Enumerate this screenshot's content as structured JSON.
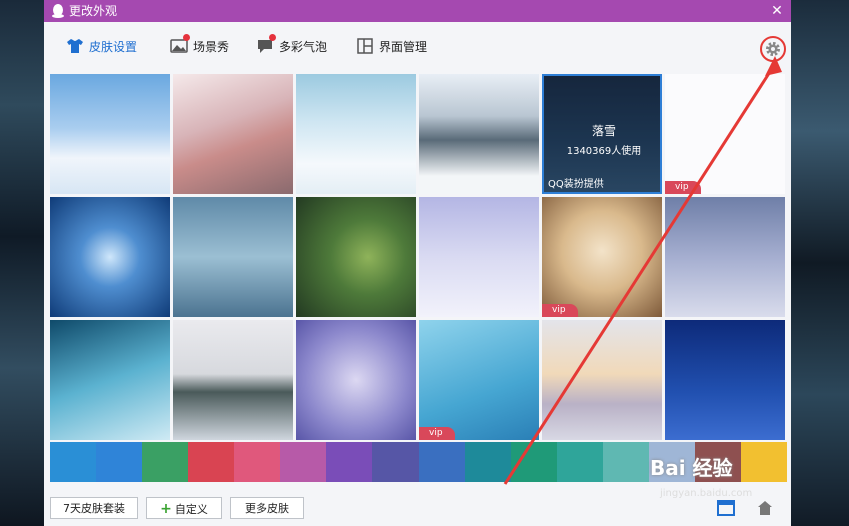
{
  "window": {
    "title": "更改外观",
    "close_symbol": "✕"
  },
  "tabs": [
    {
      "label": "皮肤设置",
      "active": true
    },
    {
      "label": "场景秀",
      "active": false
    },
    {
      "label": "多彩气泡",
      "active": false
    },
    {
      "label": "界面管理",
      "active": false
    }
  ],
  "grid": {
    "hovered": {
      "name": "落雪",
      "count": "1340369人使用",
      "provider": "QQ装扮提供"
    },
    "vip_label": "vip"
  },
  "swatches": [
    "#2a8fd6",
    "#2f84d8",
    "#3aa064",
    "#d94452",
    "#e0587c",
    "#b75aa8",
    "#7a4db8",
    "#5656a6",
    "#3a6fc0",
    "#1e8a9a",
    "#1f9a78",
    "#2fa59a",
    "#5fb8b2",
    "#9fb6d6",
    "#8e5050",
    "#f2c030"
  ],
  "footer": {
    "btn_7day": "7天皮肤套装",
    "btn_custom": "自定义",
    "btn_more": "更多皮肤"
  },
  "watermark": {
    "text": "Bai 经验",
    "url": "jingyan.baidu.com"
  },
  "colors": {
    "title_bar": "#a549b0",
    "accent": "#1f6fd0",
    "vip": "#d9485a",
    "annotation": "#e53935"
  }
}
